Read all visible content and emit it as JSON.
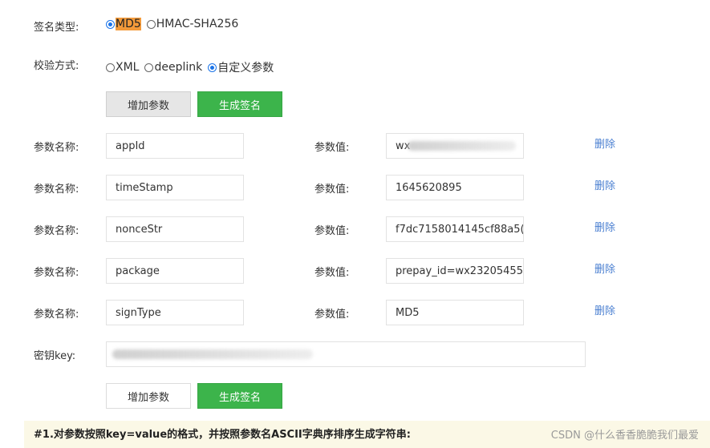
{
  "sign_type": {
    "label": "签名类型:",
    "options": [
      {
        "label": "MD5",
        "selected": true
      },
      {
        "label": "HMAC-SHA256",
        "selected": false
      }
    ]
  },
  "verify_method": {
    "label": "校验方式:",
    "options": [
      {
        "label": "XML",
        "selected": false
      },
      {
        "label": "deeplink",
        "selected": false
      },
      {
        "label": "自定义参数",
        "selected": true
      }
    ]
  },
  "buttons": {
    "add_param": "增加参数",
    "generate_sign": "生成签名"
  },
  "params": [
    {
      "name_label": "参数名称:",
      "name": "appId",
      "value_label": "参数值:",
      "value": "wx",
      "delete": "删除"
    },
    {
      "name_label": "参数名称:",
      "name": "timeStamp",
      "value_label": "参数值:",
      "value": "1645620895",
      "delete": "删除"
    },
    {
      "name_label": "参数名称:",
      "name": "nonceStr",
      "value_label": "参数值:",
      "value": "f7dc7158014145cf88a5(",
      "delete": "删除"
    },
    {
      "name_label": "参数名称:",
      "name": "package",
      "value_label": "参数值:",
      "value": "prepay_id=wx23205455",
      "delete": "删除"
    },
    {
      "name_label": "参数名称:",
      "name": "signType",
      "value_label": "参数值:",
      "value": "MD5",
      "delete": "删除"
    }
  ],
  "secret_key": {
    "label": "密钥key:",
    "value": ""
  },
  "step1": "#1.对参数按照key=value的格式，并按照参数名ASCII字典序排序生成字符串:",
  "watermark": "CSDN @什么香香脆脆我们最爱",
  "colors": {
    "primary_green": "#3cb44b",
    "link_blue": "#4a7fd1",
    "highlight": "#f39a3a"
  }
}
